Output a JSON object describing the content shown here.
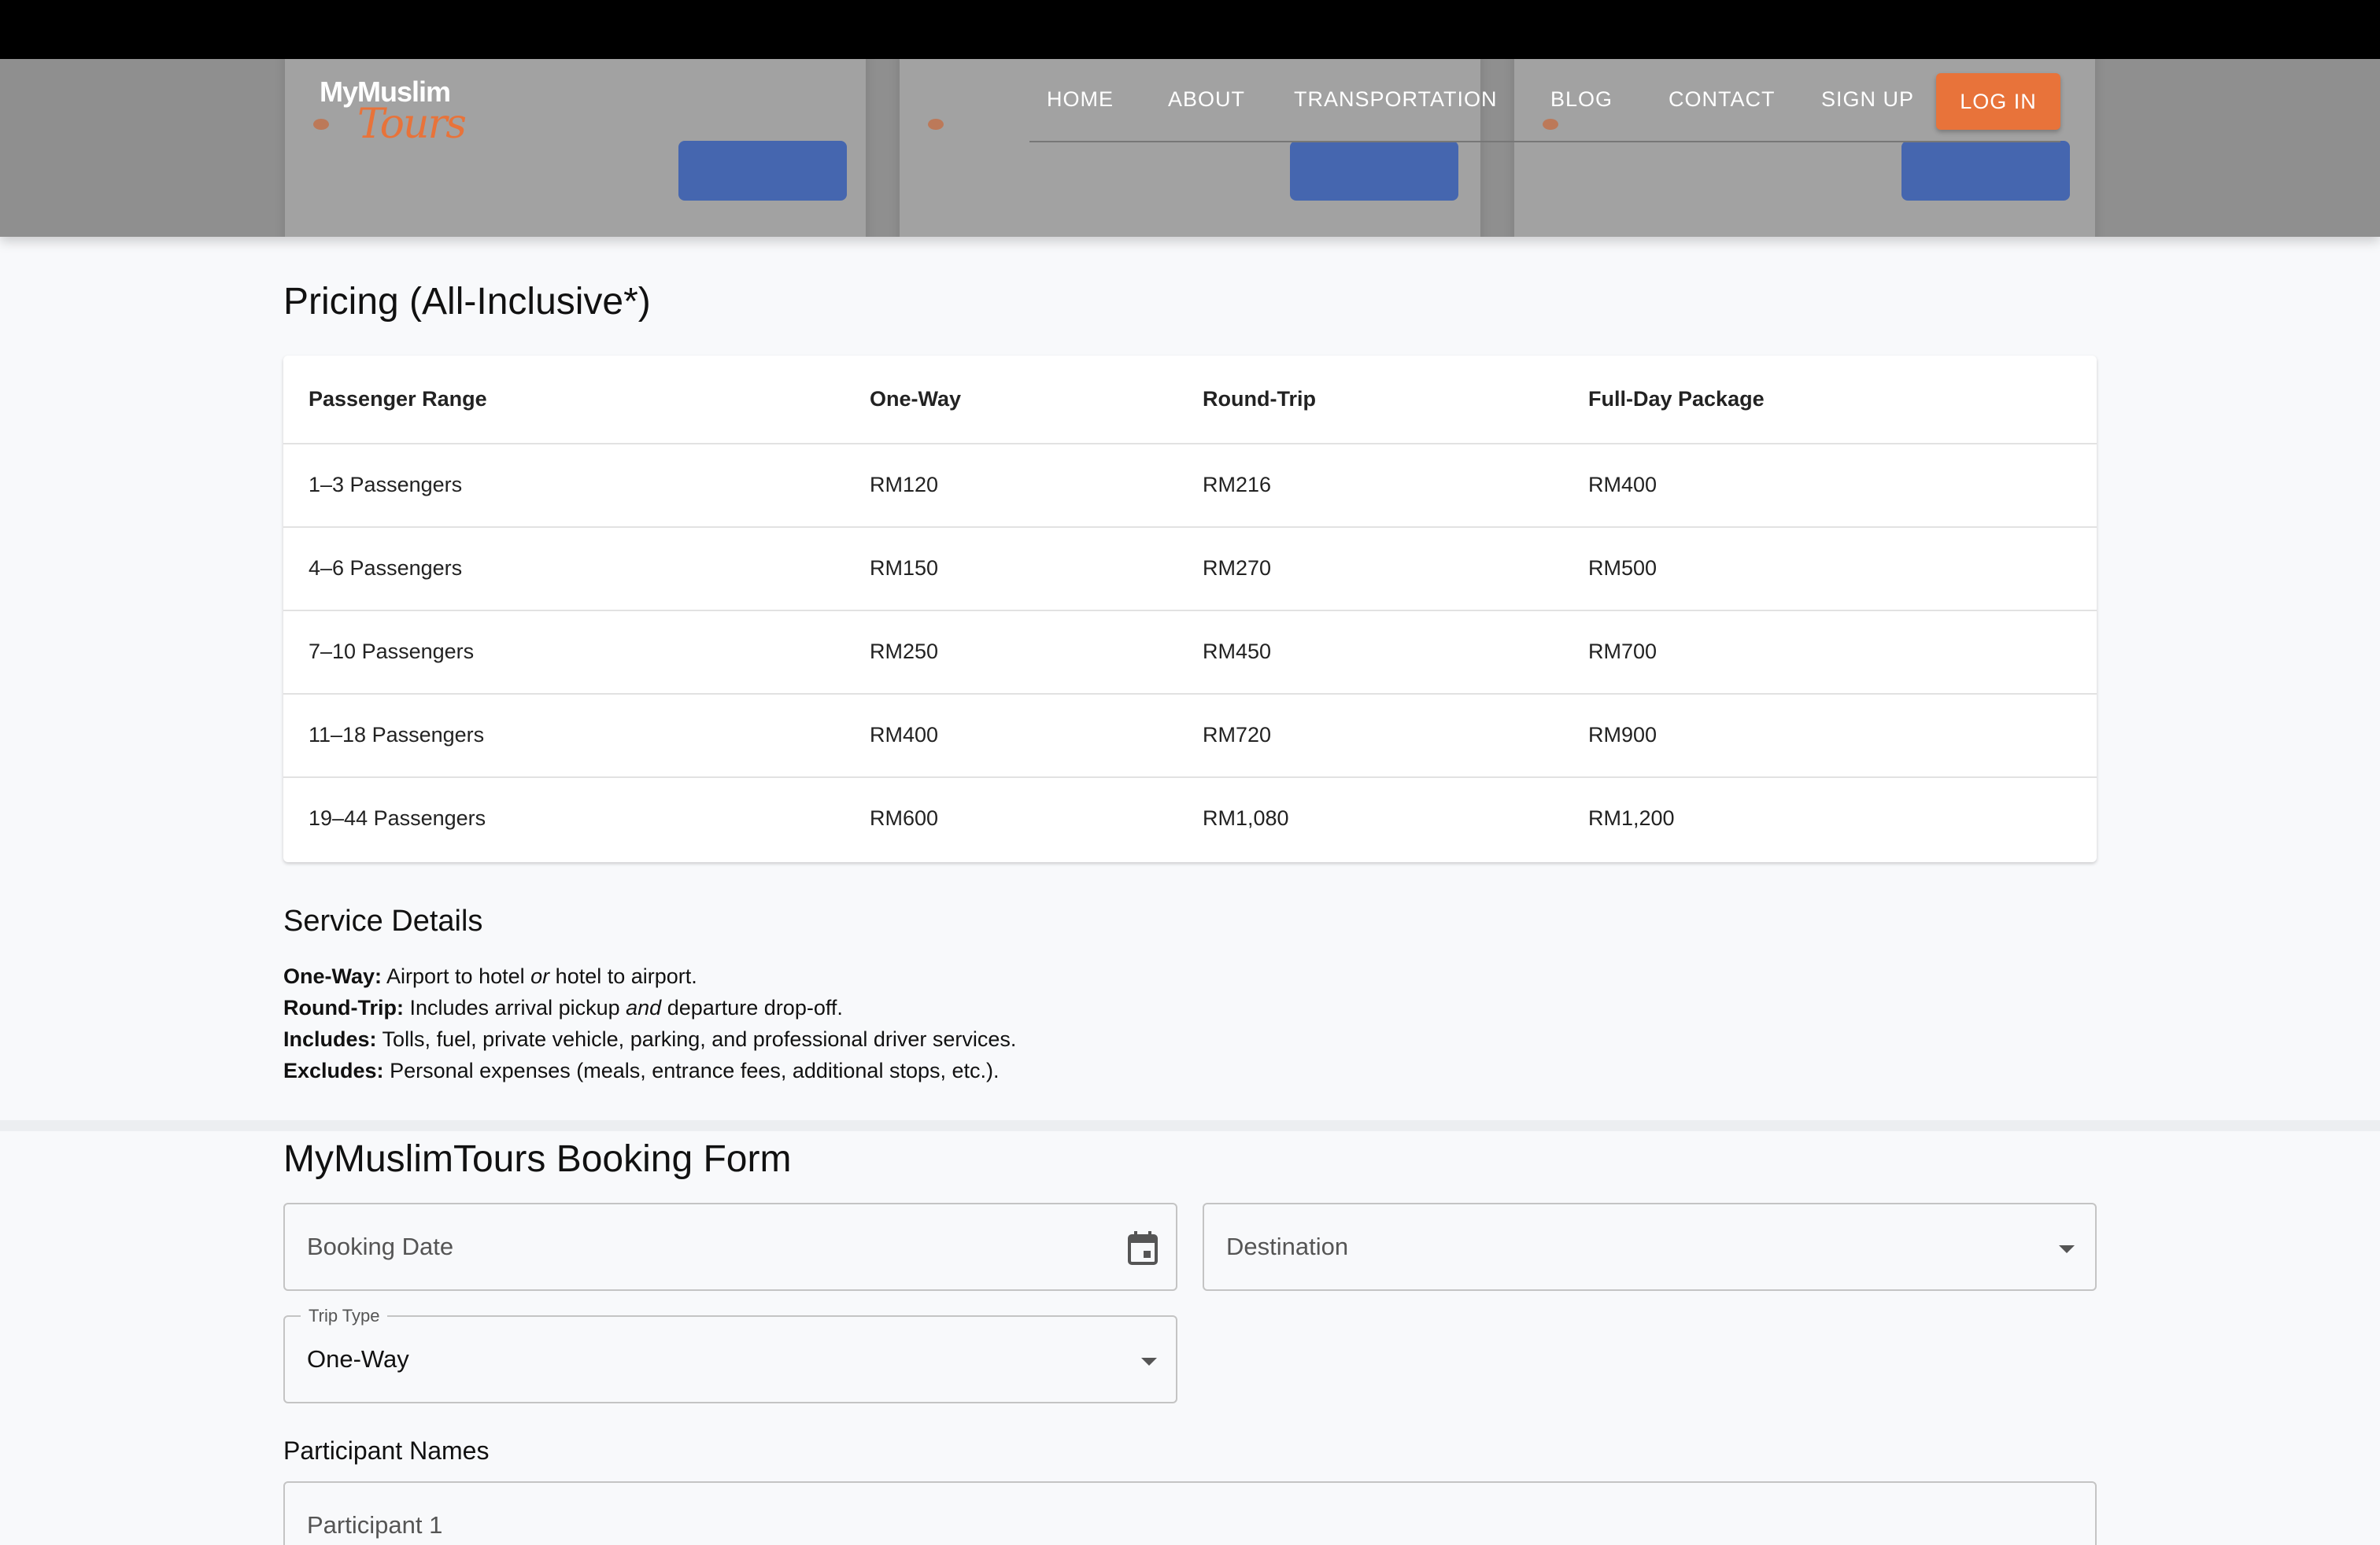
{
  "header": {
    "logo_main": "MyMuslim",
    "logo_script": "Tours",
    "nav": [
      "HOME",
      "ABOUT",
      "TRANSPORTATION",
      "BLOG",
      "CONTACT",
      "SIGN UP"
    ],
    "login_label": "LOG IN",
    "colors": {
      "accent": "#e8733a",
      "header_bg": "#8f8f8f"
    }
  },
  "pricing": {
    "title": "Pricing (All-Inclusive*)",
    "columns": [
      "Passenger Range",
      "One-Way",
      "Round-Trip",
      "Full-Day Package"
    ],
    "rows": [
      [
        "1–3 Passengers",
        "RM120",
        "RM216",
        "RM400"
      ],
      [
        "4–6 Passengers",
        "RM150",
        "RM270",
        "RM500"
      ],
      [
        "7–10 Passengers",
        "RM250",
        "RM450",
        "RM700"
      ],
      [
        "11–18 Passengers",
        "RM400",
        "RM720",
        "RM900"
      ],
      [
        "19–44 Passengers",
        "RM600",
        "RM1,080",
        "RM1,200"
      ]
    ]
  },
  "details": {
    "title": "Service Details",
    "one_way_label": "One-Way:",
    "one_way_a": "Airport to hotel",
    "one_way_or": "or",
    "one_way_b": "hotel to airport.",
    "round_trip_label": "Round-Trip:",
    "round_trip_a": "Includes arrival pickup",
    "round_trip_and": "and",
    "round_trip_b": "departure drop-off.",
    "includes_label": "Includes:",
    "includes_text": "Tolls, fuel, private vehicle, parking, and professional driver services.",
    "excludes_label": "Excludes:",
    "excludes_text": "Personal expenses (meals, entrance fees, additional stops, etc.)."
  },
  "form": {
    "title": "MyMuslimTours Booking Form",
    "booking_date_placeholder": "Booking Date",
    "destination_placeholder": "Destination",
    "trip_type_label": "Trip Type",
    "trip_type_value": "One-Way",
    "participants_label": "Participant Names",
    "participant_1_placeholder": "Participant 1"
  }
}
